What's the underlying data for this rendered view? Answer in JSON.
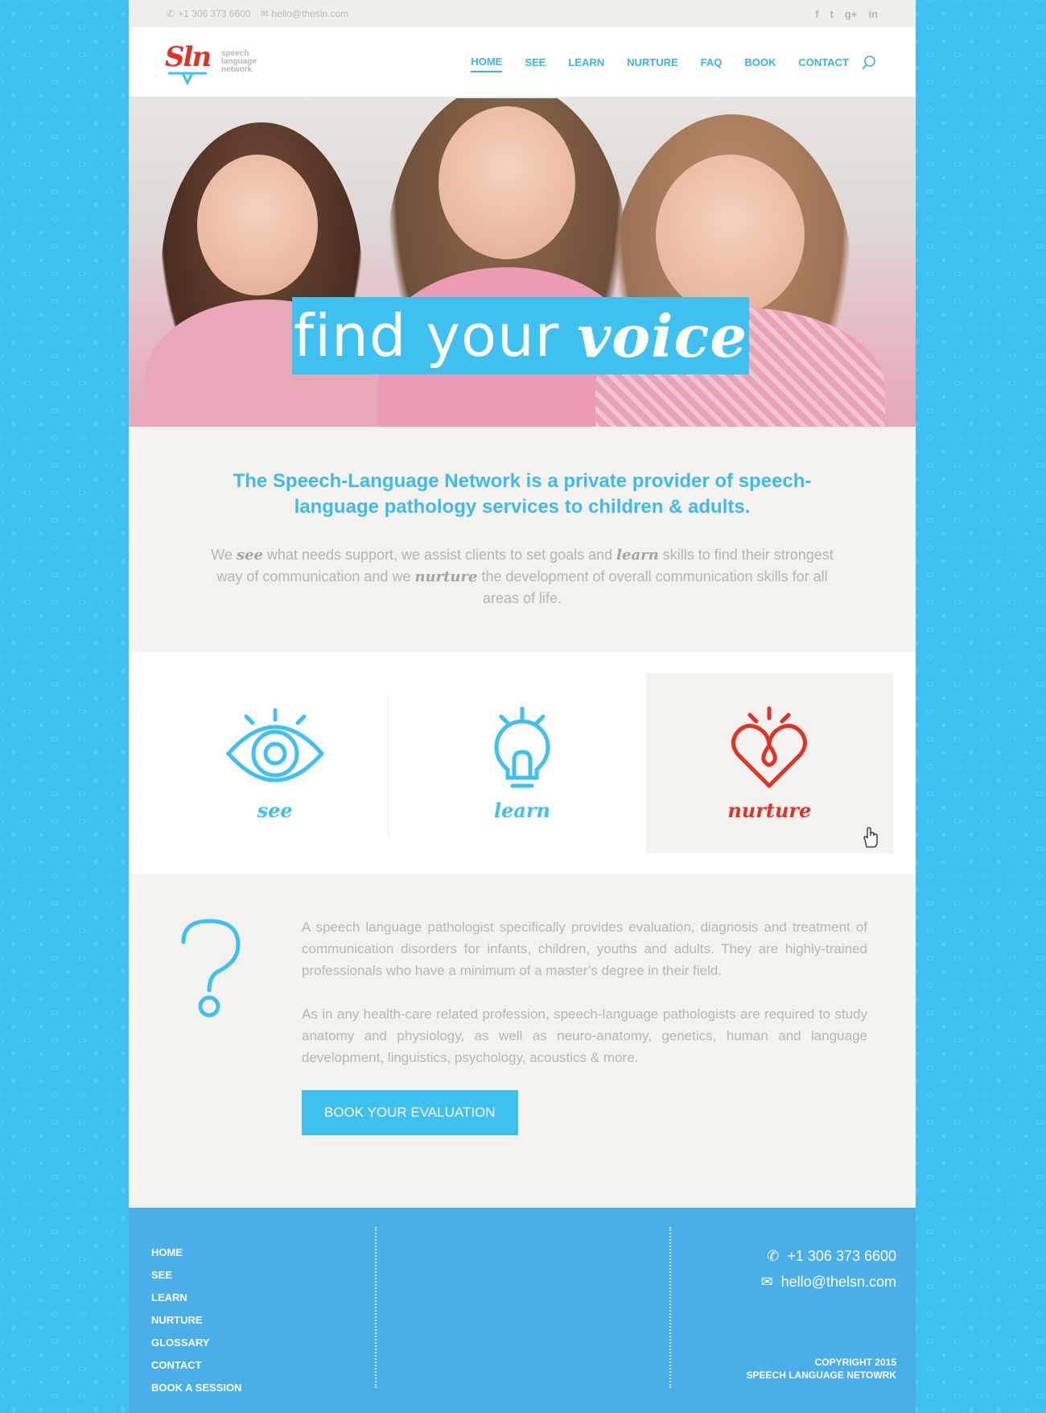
{
  "topbar": {
    "phone": "+1 306 373 6600",
    "email": "hello@thesln.com",
    "social": [
      "f",
      "t",
      "g+",
      "in"
    ]
  },
  "logo": {
    "mark": "Sln",
    "line1": "speech",
    "line2": "language",
    "line3": "network"
  },
  "nav": [
    "HOME",
    "SEE",
    "LEARN",
    "NURTURE",
    "FAQ",
    "BOOK",
    "CONTACT"
  ],
  "hero": {
    "title_plain": "find your",
    "title_script": "voice"
  },
  "intro": {
    "heading": "The Speech-Language Network is a private provider of speech-language pathology services to children & adults.",
    "p_1": "We ",
    "p_see": "see",
    "p_2": " what needs support, we assist clients to set goals and ",
    "p_learn": "learn",
    "p_3": " skills to find their strongest way of communication and we ",
    "p_nurture": "nurture",
    "p_4": " the development of overall communication skills for all areas of life."
  },
  "features": [
    {
      "label": "see",
      "icon": "eye-icon",
      "color": "#3ec0f0"
    },
    {
      "label": "learn",
      "icon": "lightbulb-icon",
      "color": "#3ec0f0"
    },
    {
      "label": "nurture",
      "icon": "heart-icon",
      "color": "#e53026"
    }
  ],
  "about": {
    "p1": "A speech language pathologist specifically provides evaluation, diagnosis and treatment of communication disorders for infants, children, youths and adults. They are highly-trained professionals who have a minimum of a master’s degree in their field.",
    "p2": "As in any health-care related profession, speech-language pathologists are required to study anatomy and physiology, as well as neuro-anatomy, genetics, human and language development, linguistics, psychology, acoustics & more.",
    "cta": "BOOK YOUR EVALUATION"
  },
  "footer": {
    "nav": [
      "HOME",
      "SEE",
      "LEARN",
      "NURTURE",
      "GLOSSARY",
      "CONTACT",
      "BOOK A SESSION"
    ],
    "phone": "+1 306 373 6600",
    "email": "hello@thelsn.com",
    "copyright_1": "COPYRIGHT 2015",
    "copyright_2": "SPEECH LANGUAGE NETOWRK"
  },
  "colors": {
    "accent": "#3ec0f0",
    "brand_red": "#e53026",
    "footer": "#4aaee8"
  }
}
